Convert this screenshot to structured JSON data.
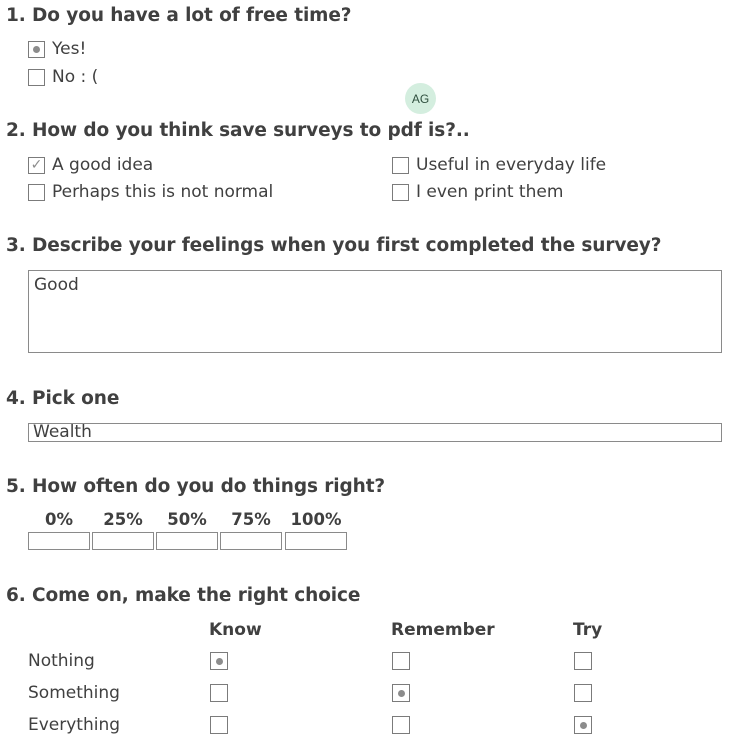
{
  "avatar": {
    "initials": "AG"
  },
  "q1": {
    "title": "1. Do you have a lot of free time?",
    "options": [
      {
        "label": "Yes!",
        "selected": true
      },
      {
        "label": "No : (",
        "selected": false
      }
    ]
  },
  "q2": {
    "title": "2. How do you think save surveys to pdf is?..",
    "options": [
      {
        "label": "A good idea",
        "checked": true
      },
      {
        "label": "Useful in everyday life",
        "checked": false
      },
      {
        "label": "Perhaps this is not normal",
        "checked": false
      },
      {
        "label": "I even print them",
        "checked": false
      }
    ]
  },
  "q3": {
    "title": "3. Describe your feelings when you first completed the survey?",
    "value": "Good"
  },
  "q4": {
    "title": "4. Pick one",
    "value": "Wealth"
  },
  "q5": {
    "title": "5. How often do you do things right?",
    "labels": [
      "0%",
      "25%",
      "50%",
      "75%",
      "100%"
    ]
  },
  "q6": {
    "title": "6. Come on, make the right choice",
    "columns": [
      "Know",
      "Remember",
      "Try"
    ],
    "rows": [
      {
        "label": "Nothing",
        "selected": 0
      },
      {
        "label": "Something",
        "selected": 1
      },
      {
        "label": "Everything",
        "selected": 2
      }
    ]
  }
}
